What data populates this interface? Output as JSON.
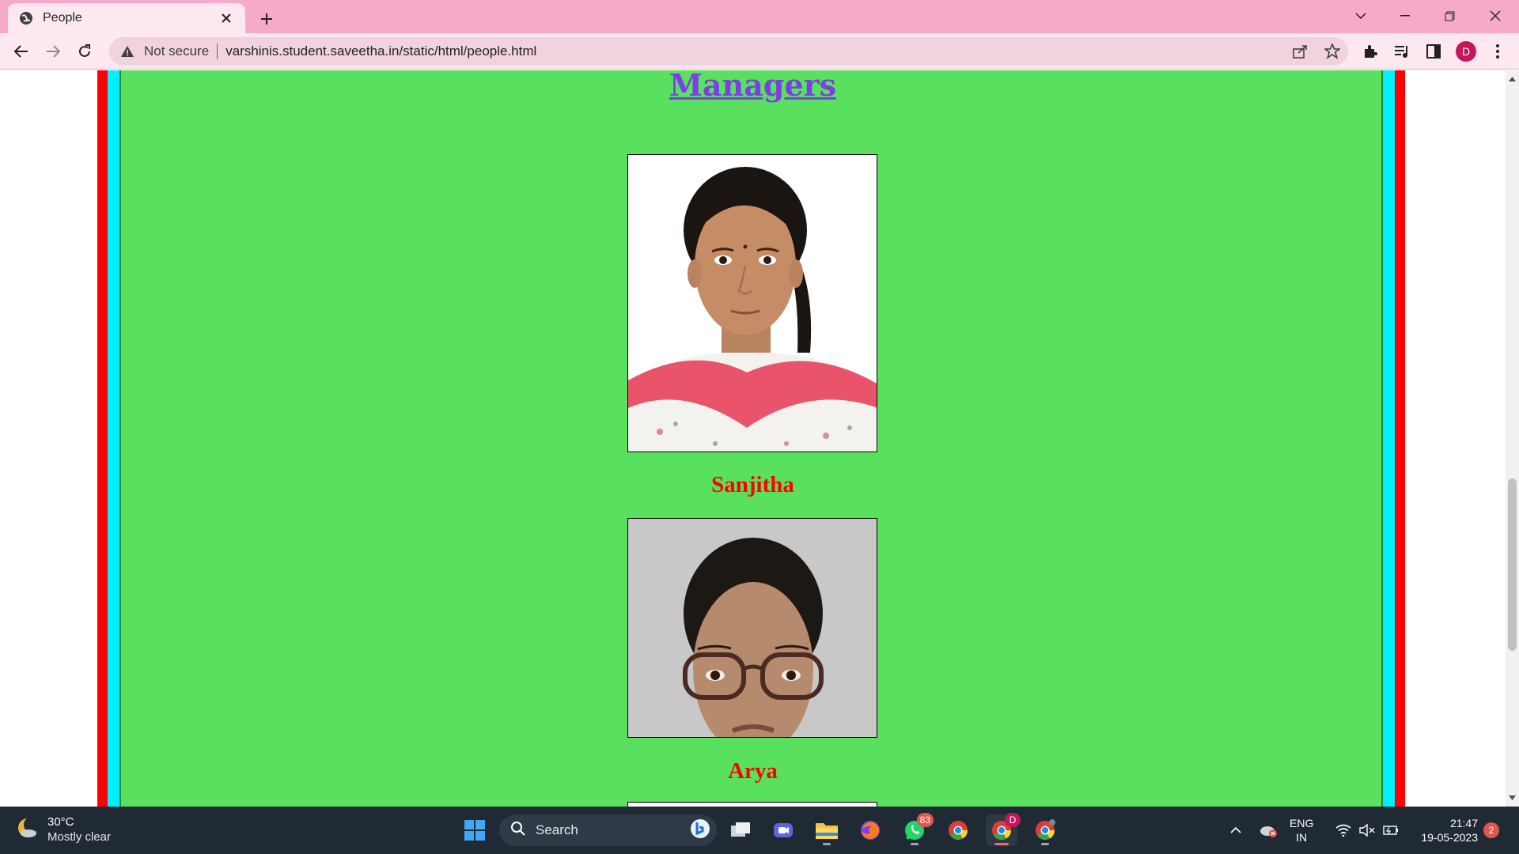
{
  "browser": {
    "tab_title": "People",
    "omnibox": {
      "security_label": "Not secure",
      "url": "varshinis.student.saveetha.in/static/html/people.html"
    },
    "profile_initial": "D"
  },
  "page": {
    "heading": "Managers",
    "people": [
      {
        "name": "Sanjitha"
      },
      {
        "name": "Arya"
      }
    ],
    "colors": {
      "outer_border": "#ff0000",
      "inner_border": "#00f0ff",
      "background": "#5ae05f",
      "heading": "#7b3fe4",
      "name": "#ff0000"
    }
  },
  "taskbar": {
    "weather": {
      "temp": "30°C",
      "condition": "Mostly clear"
    },
    "search_label": "Search",
    "whatsapp_badge": "83",
    "chrome_profile_badge": "D",
    "language": {
      "line1": "ENG",
      "line2": "IN"
    },
    "clock": {
      "time": "21:47",
      "date": "19-05-2023"
    },
    "notifications": "2"
  }
}
